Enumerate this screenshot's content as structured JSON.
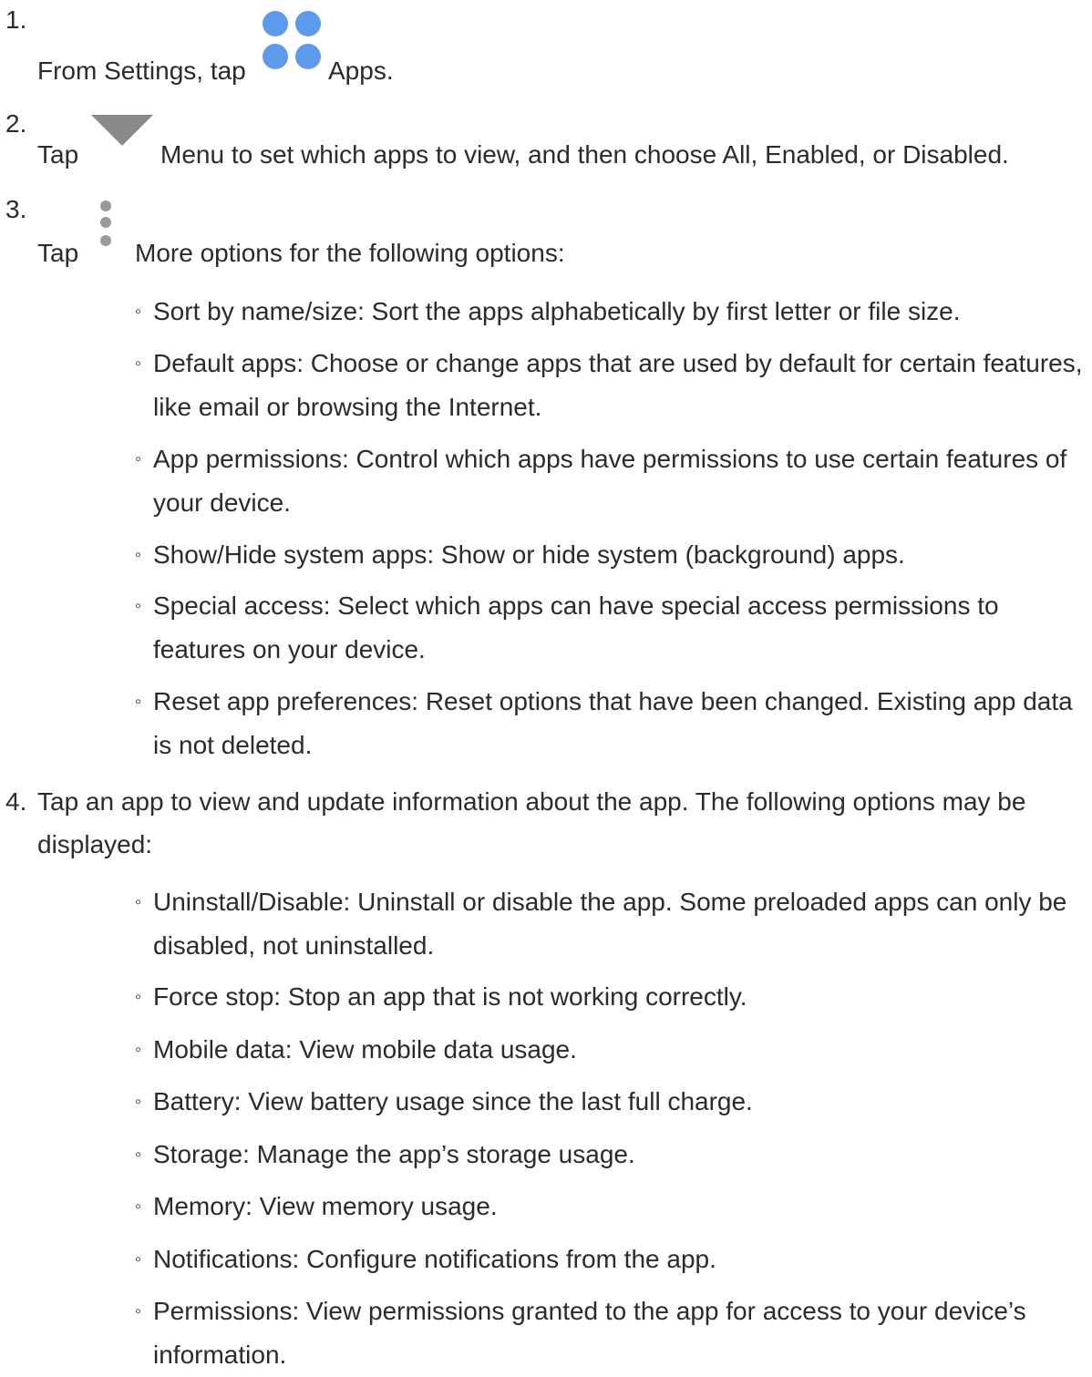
{
  "step1": {
    "num": "1.",
    "before": "From Settings, tap",
    "after": "Apps.",
    "icon": "apps-icon"
  },
  "step2": {
    "num": "2.",
    "before": "Tap",
    "after": "Menu to set which apps to view, and then choose All, Enabled, or Disabled.",
    "icon": "menu-triangle-icon"
  },
  "step3": {
    "num": "3.",
    "before": "Tap",
    "after": "More options for the following options:",
    "icon": "more-options-icon",
    "items": [
      "Sort by name/size: Sort the apps alphabetically by first letter or file size.",
      "Default apps: Choose or change apps that are used by default for certain features, like email or browsing the Internet.",
      "App permissions: Control which apps have permissions to use certain features of your device.",
      "Show/Hide system apps: Show or hide system (background) apps.",
      "Special access: Select which apps can have special access permissions to features on your device.",
      "Reset app preferences: Reset options that have been changed. Existing app data is not deleted."
    ]
  },
  "step4": {
    "num": "4.",
    "line1": "Tap an app to view and update information about the app. The following options may be",
    "line2": "displayed:",
    "items": [
      "Uninstall/Disable: Uninstall or disable the app. Some preloaded apps can only be disabled, not uninstalled.",
      "Force stop: Stop an app that is not working correctly.",
      "Mobile data: View mobile data usage.",
      "Battery: View battery usage since the last full charge.",
      "Storage: Manage the app’s storage usage.",
      "Memory: View memory usage.",
      "Notifications: Configure notifications from the app.",
      "Permissions: View permissions granted to the app for access to your device’s information."
    ]
  },
  "bullet": "◦",
  "colors": {
    "text": "#2b2b2b",
    "apps_icon": "#5c9bec",
    "menu_icon": "#8a8a8a",
    "more_icon": "#9a9a9a"
  }
}
